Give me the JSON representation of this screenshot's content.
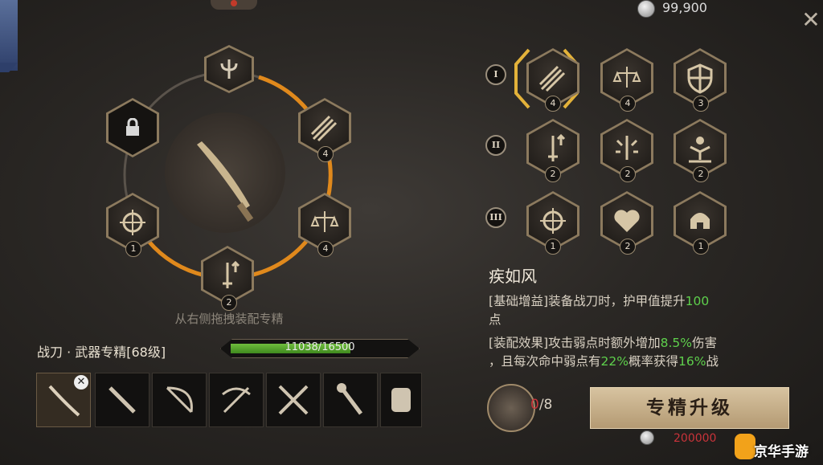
{
  "currency": {
    "amount": "99,900",
    "icon": "silver-coin-icon"
  },
  "close_icon": "✕",
  "specialization": {
    "hint": "从右侧拖拽装配专精",
    "title": "战刀 · 武器专精[68级]",
    "xp_text": "11038/16500",
    "xp_current": 11038,
    "xp_max": 16500,
    "center_icon": "sabre-icon",
    "top_icon": "trident-emblem-icon",
    "ring_nodes": [
      {
        "name": "lock-icon",
        "badge": ""
      },
      {
        "name": "triple-arrow-icon",
        "badge": "4"
      },
      {
        "name": "scales-icon",
        "badge": "4"
      },
      {
        "name": "sword-up-arrow-icon",
        "badge": "2"
      },
      {
        "name": "crosshair-shield-icon",
        "badge": "1"
      }
    ]
  },
  "tiers": [
    {
      "mark": "I",
      "skills": [
        {
          "icon": "triple-arrow-icon",
          "level": "4"
        },
        {
          "icon": "scales-icon",
          "level": "4"
        },
        {
          "icon": "shield-icon",
          "level": "3"
        }
      ]
    },
    {
      "mark": "II",
      "skills": [
        {
          "icon": "sword-up-arrow-icon",
          "level": "2"
        },
        {
          "icon": "sword-burst-icon",
          "level": "2"
        },
        {
          "icon": "warrior-icon",
          "level": "2"
        }
      ]
    },
    {
      "mark": "III",
      "skills": [
        {
          "icon": "crosshair-shield-icon",
          "level": "1"
        },
        {
          "icon": "heart-icon",
          "level": "2"
        },
        {
          "icon": "helmet-icon",
          "level": "1"
        }
      ]
    }
  ],
  "skill": {
    "name": "疾如风",
    "base_prefix": "[基础增益]装备战刀时，护甲值提升",
    "base_value": "100",
    "base_suffix": "点",
    "equip_prefix": "[装配效果]攻击弱点时额外增加",
    "equip_v1": "8.5%",
    "equip_mid1": "伤害",
    "equip_line2a": "，且每次命中弱点有",
    "equip_v2": "22%",
    "equip_mid2": "概率获得",
    "equip_v3": "16%",
    "equip_end": "战"
  },
  "weapons": [
    "sabre-icon",
    "dagger-icon",
    "bow-icon",
    "crossbow-icon",
    "crossed-swords-icon",
    "torch-mace-icon",
    "fist-icon"
  ],
  "selected_mark": "✕",
  "material": {
    "icon": "hammer-book-icon",
    "count_red": "0",
    "count_sep": "/8"
  },
  "upgrade": {
    "label": "专精升级",
    "cost": "200000"
  },
  "watermark": "京华手游",
  "colors": {
    "accent_orange": "#e0891c",
    "xp_green": "#5cb43a",
    "value_green": "#5ed04c",
    "cost_red": "#c9333a"
  }
}
